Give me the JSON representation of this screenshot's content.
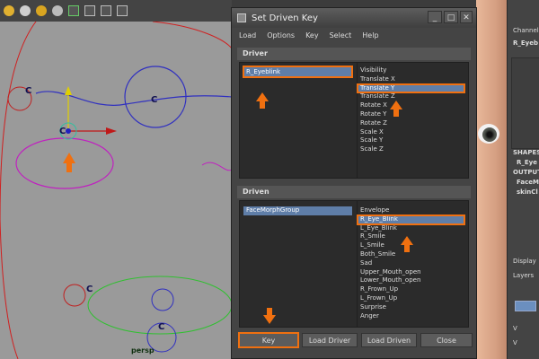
{
  "dialog": {
    "title": "Set Driven Key",
    "menu": [
      "Load",
      "Options",
      "Key",
      "Select",
      "Help"
    ],
    "driver_section": "Driver",
    "driven_section": "Driven",
    "driver_objects": [
      "R_Eyeblink"
    ],
    "driver_attributes": [
      "Visibility",
      "Translate X",
      "Translate Y",
      "Translate Z",
      "Rotate X",
      "Rotate Y",
      "Rotate Z",
      "Scale X",
      "Scale Y",
      "Scale Z"
    ],
    "driven_objects": [
      "FaceMorphGroup"
    ],
    "driven_attributes": [
      "Envelope",
      "R_Eye_Blink",
      "L_Eye_Blink",
      "R_Smile",
      "L_Smile",
      "Both_Smile",
      "Sad",
      "Upper_Mouth_open",
      "Lower_Mouth_open",
      "R_Frown_Up",
      "L_Frown_Up",
      "Surprise",
      "Anger"
    ],
    "selected": {
      "driver_object": "R_Eyeblink",
      "driver_attribute": "Translate Y",
      "driven_object": "FaceMorphGroup",
      "driven_attribute": "R_Eye_Blink"
    },
    "buttons": {
      "key": "Key",
      "load_driver": "Load Driver",
      "load_driven": "Load Driven",
      "close": "Close"
    },
    "win_buttons": {
      "minimize": "_",
      "maximize": "□",
      "close": "✕"
    }
  },
  "viewport": {
    "camera": "persp",
    "control_labels": [
      "C",
      "C",
      "C",
      "C",
      "C"
    ]
  },
  "channel_box": {
    "header": "Channel",
    "object": "R_Eyeb",
    "shapes": "SHAPES",
    "shape_name": "R_Eye",
    "outputs": "OUTPUT",
    "outputs_list": [
      "FaceM",
      "skinCl"
    ],
    "display_tab": "Display",
    "layers_tab": "Layers",
    "v_marks": [
      "V",
      "V"
    ]
  },
  "colors": {
    "highlight": "#f07010",
    "selection": "#5f7ea8",
    "viewport_bg": "#9a9a9a"
  }
}
